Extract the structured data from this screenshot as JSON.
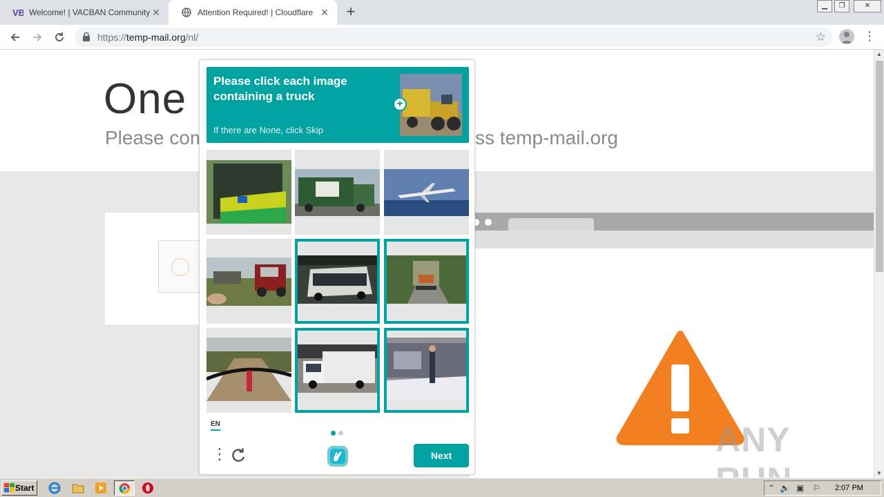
{
  "browser": {
    "tabs": [
      {
        "title": "Welcome! | VACBAN Community",
        "favicon": "vb-logo-icon",
        "active": false
      },
      {
        "title": "Attention Required! | Cloudflare",
        "favicon": "globe-icon",
        "active": true
      }
    ],
    "url": {
      "prefix": "https://",
      "host": "temp-mail.org",
      "path": "/nl/"
    }
  },
  "page": {
    "title": "One m",
    "subtitle_left": "Please com",
    "subtitle_right": "ss temp-mail.org",
    "watermark": "ANY RUN"
  },
  "captcha": {
    "prompt_line1": "Please click each image",
    "prompt_line2": "containing a truck",
    "hint": "If there are None, click Skip",
    "language": "EN",
    "next_label": "Next",
    "accent_color": "#00a2a2",
    "pages_total": 2,
    "page_active": 1,
    "tiles": [
      {
        "subject": "bus",
        "selected": false
      },
      {
        "subject": "garbage-truck",
        "selected": false
      },
      {
        "subject": "airplane",
        "selected": false
      },
      {
        "subject": "red-truck-crowd",
        "selected": false
      },
      {
        "subject": "bus-in-garage",
        "selected": true
      },
      {
        "subject": "truck-on-road",
        "selected": true
      },
      {
        "subject": "bicycle-trail",
        "selected": false
      },
      {
        "subject": "white-box-truck",
        "selected": true
      },
      {
        "subject": "truck-snow",
        "selected": true
      }
    ]
  },
  "taskbar": {
    "start_label": "Start",
    "clock": "2:07 PM"
  }
}
